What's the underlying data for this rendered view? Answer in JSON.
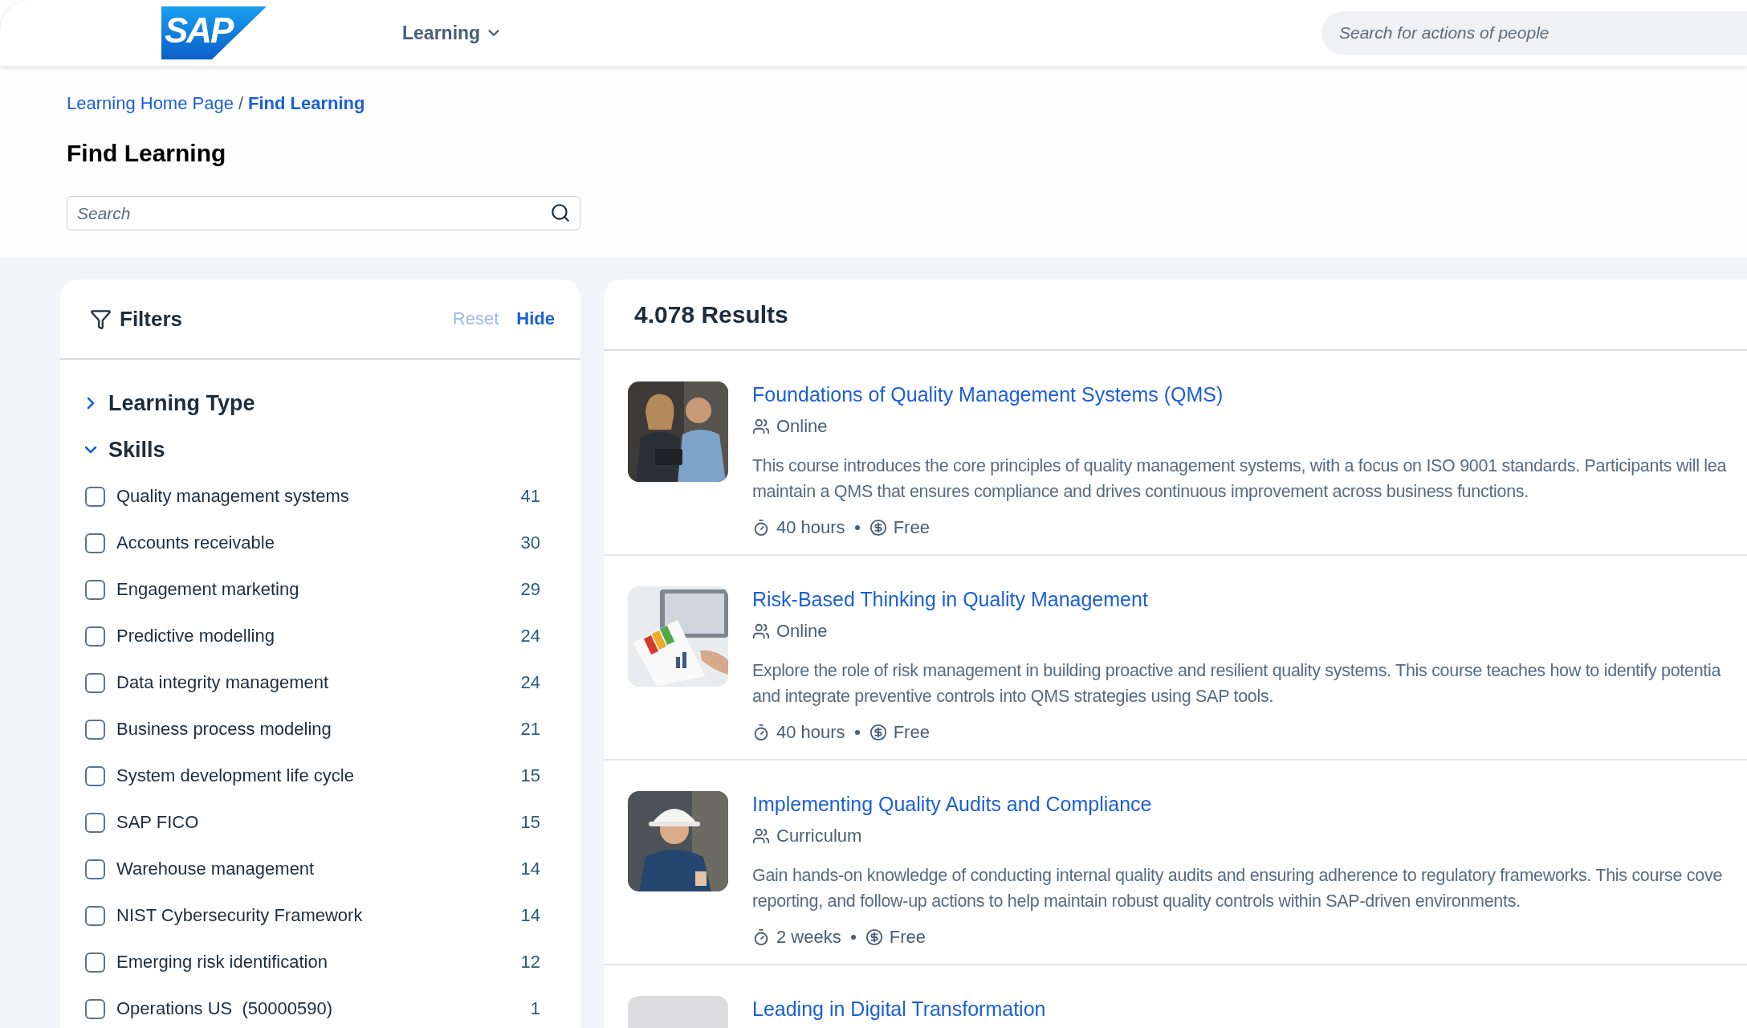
{
  "header": {
    "logo": "SAP",
    "nav": {
      "label": "Learning"
    },
    "search": {
      "placeholder": "Search for actions of people"
    }
  },
  "breadcrumb": {
    "separator": "/",
    "items": [
      {
        "label": "Learning Home Page",
        "current": false
      },
      {
        "label": "Find Learning",
        "current": true
      }
    ]
  },
  "page_title": "Find Learning",
  "search": {
    "placeholder": "Search"
  },
  "filters": {
    "title": "Filters",
    "reset": {
      "label": "Reset",
      "disabled": true
    },
    "hide": {
      "label": "Hide",
      "disabled": false
    },
    "sections": [
      {
        "label": "Learning Type",
        "expanded": false
      },
      {
        "label": "Skills",
        "expanded": true,
        "options": [
          {
            "label": "Quality management systems",
            "count": "41",
            "checked": false
          },
          {
            "label": "Accounts receivable",
            "count": "30",
            "checked": false
          },
          {
            "label": "Engagement marketing",
            "count": "29",
            "checked": false
          },
          {
            "label": "Predictive modelling",
            "count": "24",
            "checked": false
          },
          {
            "label": "Data integrity management",
            "count": "24",
            "checked": false
          },
          {
            "label": "Business process modeling",
            "count": "21",
            "checked": false
          },
          {
            "label": "System development life cycle",
            "count": "15",
            "checked": false
          },
          {
            "label": "SAP FICO",
            "count": "15",
            "checked": false
          },
          {
            "label": "Warehouse management",
            "count": "14",
            "checked": false
          },
          {
            "label": "NIST Cybersecurity Framework",
            "count": "14",
            "checked": false
          },
          {
            "label": "Emerging risk identification",
            "count": "12",
            "checked": false
          },
          {
            "label": "Operations US  (50000590)",
            "count": "1",
            "checked": false
          }
        ]
      }
    ]
  },
  "results": {
    "count": "4.078 Results",
    "items": [
      {
        "title": "Foundations of Quality Management Systems (QMS)",
        "type": "Online",
        "description": [
          "This course introduces the core principles of quality management systems, with a focus on ISO 9001 standards. Participants will lea",
          "maintain a QMS that ensures compliance and drives continuous improvement across business functions."
        ],
        "duration": "40 hours",
        "price": "Free"
      },
      {
        "title": "Risk-Based Thinking in Quality Management",
        "type": "Online",
        "description": [
          "Explore the role of risk management in building proactive and resilient quality systems. This course teaches how to identify potentia",
          "and integrate preventive controls into QMS strategies using SAP tools."
        ],
        "duration": "40 hours",
        "price": "Free"
      },
      {
        "title": "Implementing Quality Audits and Compliance",
        "type": "Curriculum",
        "description": [
          "Gain hands-on knowledge of conducting internal quality audits and ensuring adherence to regulatory frameworks. This course cove",
          "reporting, and follow-up actions to help maintain robust quality controls within SAP-driven environments."
        ],
        "duration": "2 weeks",
        "price": "Free"
      },
      {
        "image": {
          "kind": "placeholder"
        },
        "title": "Leading in Digital Transformation"
      }
    ]
  }
}
